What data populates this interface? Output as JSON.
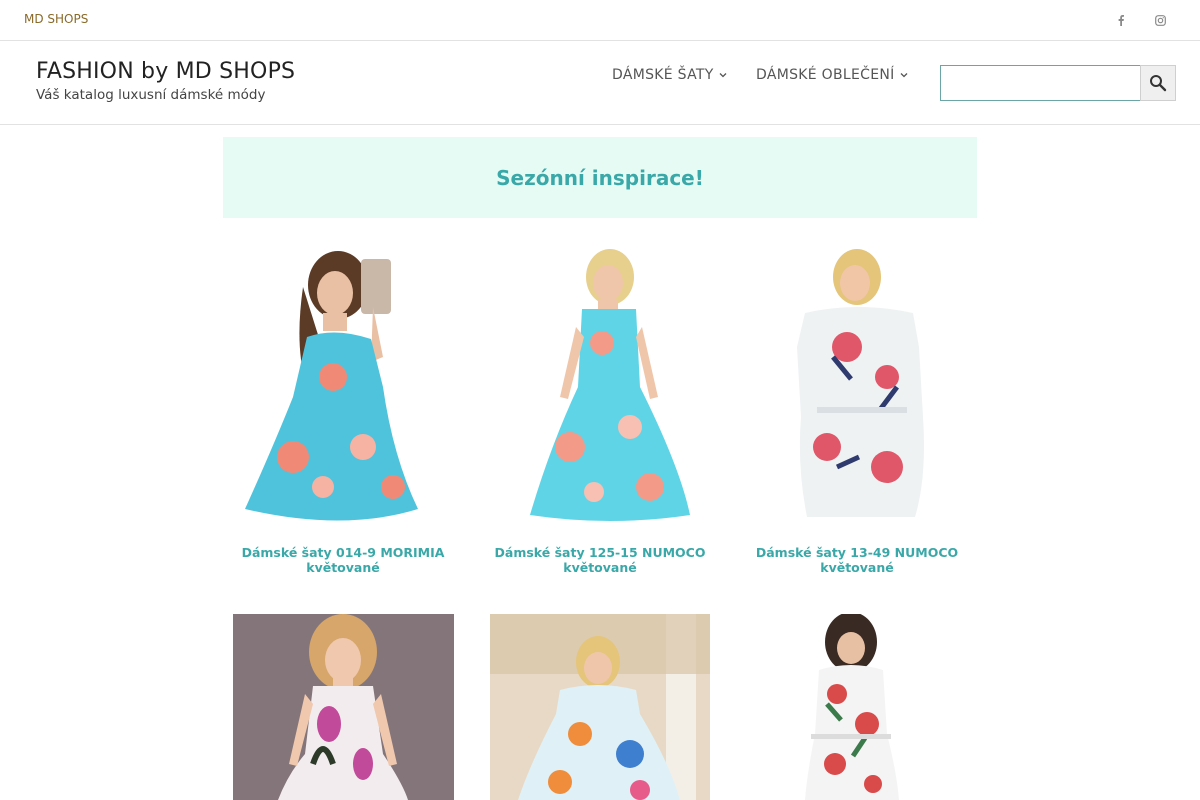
{
  "topbar": {
    "brand": "MD SHOPS",
    "social": [
      {
        "icon": "facebook-icon",
        "glyph": "f"
      },
      {
        "icon": "instagram-icon"
      }
    ]
  },
  "header": {
    "title": "FASHION by MD SHOPS",
    "tagline": "Váš katalog luxusní dámské módy",
    "nav": [
      {
        "label": "DÁMSKÉ ŠATY",
        "icon": "chevron-down-icon"
      },
      {
        "label": "DÁMSKÉ OBLEČENÍ",
        "icon": "chevron-down-icon"
      }
    ],
    "search": {
      "value": "",
      "placeholder": "",
      "icon": "search-icon"
    }
  },
  "banner": {
    "text": "Sezónní inspirace!"
  },
  "products": [
    {
      "title": "Dámské šaty 014-9 MORIMIA květované",
      "dress_color": "#4fc3dc",
      "accent": "#f08a76"
    },
    {
      "title": "Dámské šaty 125-15 NUMOCO květované",
      "dress_color": "#5fd4e6",
      "accent": "#f39a88"
    },
    {
      "title": "Dámské šaty 13-49 NUMOCO květované",
      "dress_color": "#eef2f3",
      "accent": "#e0576a"
    },
    {
      "title": "",
      "dress_color": "#f3ecef",
      "accent": "#c24a9a"
    },
    {
      "title": "",
      "dress_color": "#dff1f6",
      "accent": "#ef8d3c"
    },
    {
      "title": "",
      "dress_color": "#f4f4f4",
      "accent": "#d94a4a"
    }
  ],
  "colors": {
    "accent_teal": "#3aa8a8",
    "banner_bg": "#e6fbf4",
    "brand_gold": "#8a6a2a"
  }
}
